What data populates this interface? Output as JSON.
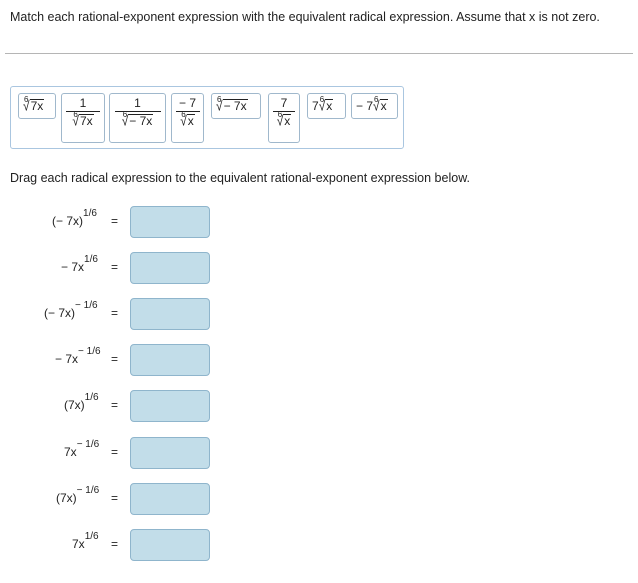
{
  "instructions": "Match each rational-exponent expression with the equivalent radical expression. Assume that x is not zero.",
  "drag_instructions": "Drag each radical expression to the equivalent rational-exponent expression below.",
  "tiles": {
    "t1": {
      "index": "6",
      "radicand": "7x"
    },
    "t2": {
      "numerator": "1",
      "index": "6",
      "radicand": "7x"
    },
    "t3": {
      "numerator": "1",
      "index": "6",
      "radicand": "− 7x"
    },
    "t4": {
      "numerator": "− 7",
      "index": "6",
      "radicand": "x"
    },
    "t5": {
      "index": "6",
      "radicand": "− 7x"
    },
    "t6": {
      "numerator": "7",
      "index": "6",
      "radicand": "x"
    },
    "t7": {
      "coef": "7",
      "index": "6",
      "radicand": "x"
    },
    "t8": {
      "coef": "− 7",
      "index": "6",
      "radicand": "x"
    }
  },
  "rows": [
    {
      "base": "(− 7x)",
      "exp": "1/6"
    },
    {
      "base": "− 7x",
      "exp": "1/6"
    },
    {
      "base": "(− 7x)",
      "exp": "− 1/6"
    },
    {
      "base": "− 7x",
      "exp": "− 1/6"
    },
    {
      "base": "(7x)",
      "exp": "1/6"
    },
    {
      "base": "7x",
      "exp": "− 1/6"
    },
    {
      "base": "(7x)",
      "exp": "− 1/6"
    },
    {
      "base": "7x",
      "exp": "1/6"
    }
  ],
  "equals": "=",
  "colors": {
    "drop_fill": "#c2dde9",
    "drop_border": "#8fb5cc",
    "pool_border": "#aac6e0"
  }
}
